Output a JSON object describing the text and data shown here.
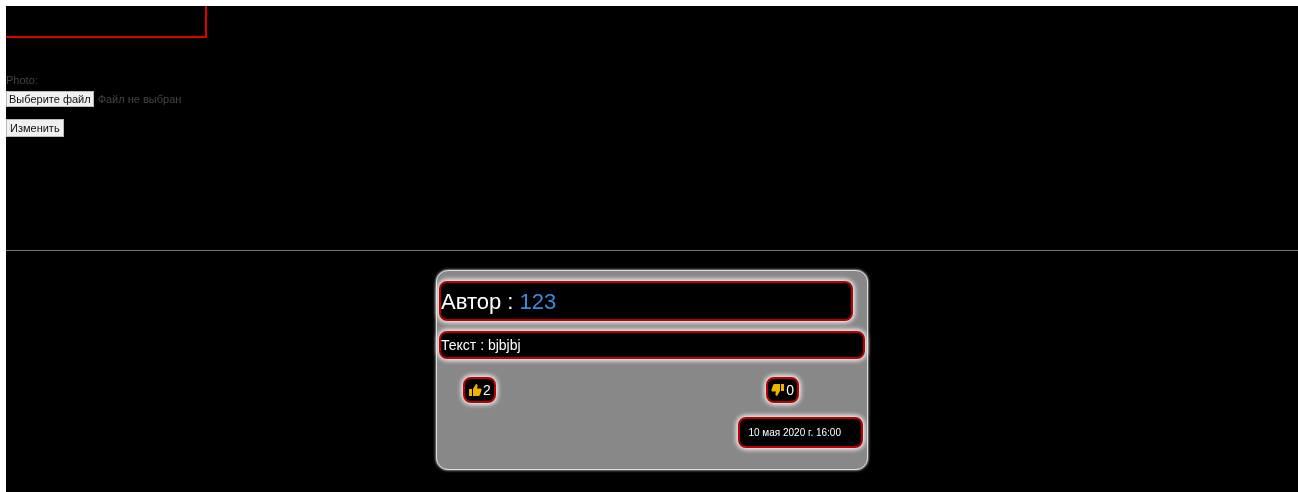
{
  "form": {
    "photo_label": "Photo:",
    "file_button": "Выберите файл",
    "file_status": "Файл не выбран",
    "submit_button": "Изменить"
  },
  "comment": {
    "author_label": "Автор : ",
    "author": "123",
    "text": "Текст : bjbjbj",
    "likes": "2",
    "dislikes": "0",
    "date": "10 мая 2020 г. 16:00"
  }
}
